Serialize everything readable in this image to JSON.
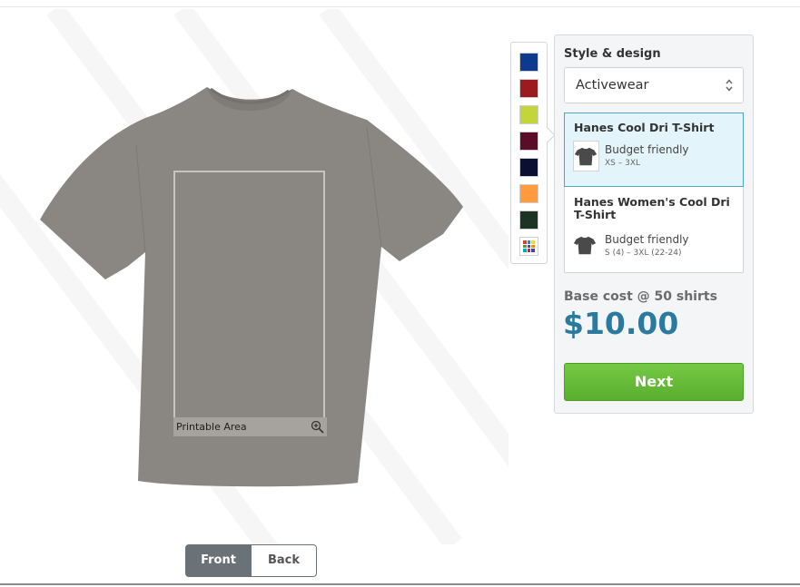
{
  "preview": {
    "printable_area_label": "Printable Area",
    "views": [
      {
        "label": "Front",
        "active": true
      },
      {
        "label": "Back",
        "active": false
      }
    ]
  },
  "swatches": [
    {
      "name": "royal-blue",
      "color": "#0d3a8e"
    },
    {
      "name": "red",
      "color": "#9c1b1e"
    },
    {
      "name": "lime",
      "color": "#c4d53a"
    },
    {
      "name": "maroon",
      "color": "#5a0c28"
    },
    {
      "name": "navy",
      "color": "#0b1033"
    },
    {
      "name": "orange",
      "color": "#ff9b3c"
    },
    {
      "name": "forest",
      "color": "#1d3324"
    },
    {
      "name": "more-colors",
      "icon": "multicolor-grid-icon"
    }
  ],
  "style": {
    "heading": "Style & design",
    "selected": "Activewear"
  },
  "products": [
    {
      "name": "Hanes Cool Dri T-Shirt",
      "tag": "Budget friendly",
      "sizes": "XS – 3XL",
      "selected": true
    },
    {
      "name": "Hanes Women's Cool Dri T-Shirt",
      "tag": "Budget friendly",
      "sizes": "S (4) – 3XL (22-24)",
      "selected": false
    }
  ],
  "pricing": {
    "label": "Base cost @ 50 shirts",
    "value": "$10.00"
  },
  "actions": {
    "next": "Next"
  },
  "colors": {
    "shirt": "#8a8783",
    "accent": "#2a7aa0",
    "next_green": "#63b935",
    "selected_product_bg": "#e4f4fb"
  }
}
